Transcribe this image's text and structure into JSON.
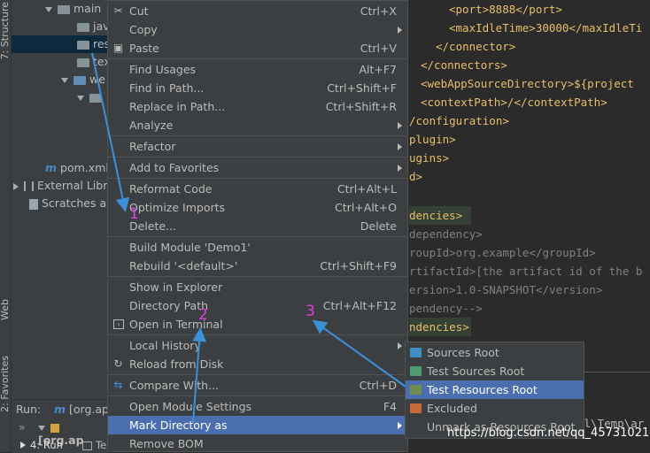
{
  "toolstrip": {
    "structure_label": "7: Structure",
    "web_label": "Web",
    "favorites_label": "2: Favorites"
  },
  "tree": {
    "rows": [
      {
        "label": "main"
      },
      {
        "label": "java"
      },
      {
        "label": "res"
      },
      {
        "label": "tex"
      },
      {
        "label": "we"
      },
      {
        "label": ""
      },
      {
        "label": "pom.xml"
      },
      {
        "label": "External Libr"
      },
      {
        "label": "Scratches an"
      }
    ]
  },
  "run_panel": {
    "run_label": "Run:",
    "run_config": "[org.ap",
    "run_config2": "[org.ap",
    "tab_run": "4: Run",
    "tab_te": "Te"
  },
  "editor": {
    "lines": [
      {
        "indent": "    ",
        "text": "<port>8888</port>"
      },
      {
        "indent": "    ",
        "text": "<maxIdleTime>30000</maxIdleTi"
      },
      {
        "indent": "  ",
        "text": "</connector>"
      },
      {
        "indent": "",
        "text": "</connectors>"
      },
      {
        "indent": "",
        "text": "<webAppSourceDirectory>${project"
      },
      {
        "indent": "",
        "text": "<contextPath>/</contextPath>"
      },
      {
        "indent": "",
        "text": "/configuration>"
      },
      {
        "indent": "",
        "text": "plugin>"
      },
      {
        "indent": "",
        "text": "ugins>"
      },
      {
        "indent": "",
        "text": "d>"
      },
      {
        "indent": "",
        "text": ""
      },
      {
        "indent": "",
        "text": "dencies>"
      },
      {
        "indent": "",
        "text": "dependency>"
      },
      {
        "indent": "",
        "text": "roupId>org.example</groupId>"
      },
      {
        "indent": "",
        "text": "rtifactId>[the artifact id of the b"
      },
      {
        "indent": "",
        "text": "ersion>1.0-SNAPSHOT</version>"
      },
      {
        "indent": "",
        "text": "pendency-->"
      },
      {
        "indent": "",
        "text": "ndencies>"
      }
    ],
    "bottom_text": "al\\Temp\\ar"
  },
  "menu": {
    "items": [
      {
        "label": "Cut",
        "shortcut": "Ctrl+X",
        "icon": "scissors-icon"
      },
      {
        "label": "Copy",
        "shortcut": "",
        "submenu": true
      },
      {
        "label": "Paste",
        "shortcut": "Ctrl+V",
        "icon": "clipboard-icon"
      },
      {
        "label": "Find Usages",
        "shortcut": "Alt+F7"
      },
      {
        "label": "Find in Path...",
        "shortcut": "Ctrl+Shift+F"
      },
      {
        "label": "Replace in Path...",
        "shortcut": "Ctrl+Shift+R"
      },
      {
        "label": "Analyze",
        "shortcut": "",
        "submenu": true
      },
      {
        "label": "Refactor",
        "shortcut": "",
        "submenu": true
      },
      {
        "label": "Add to Favorites",
        "shortcut": "",
        "submenu": true
      },
      {
        "label": "Reformat Code",
        "shortcut": "Ctrl+Alt+L"
      },
      {
        "label": "Optimize Imports",
        "shortcut": "Ctrl+Alt+O"
      },
      {
        "label": "Delete...",
        "shortcut": "Delete"
      },
      {
        "label": "Build Module 'Demo1'",
        "shortcut": ""
      },
      {
        "label": "Rebuild '<default>'",
        "shortcut": "Ctrl+Shift+F9"
      },
      {
        "label": "Show in Explorer",
        "shortcut": ""
      },
      {
        "label": "Directory Path",
        "shortcut": "Ctrl+Alt+F12"
      },
      {
        "label": "Open in Terminal",
        "shortcut": "",
        "icon": "terminal-icon"
      },
      {
        "label": "Local History",
        "shortcut": "",
        "submenu": true
      },
      {
        "label": "Reload from Disk",
        "shortcut": "",
        "icon": "reload-icon"
      },
      {
        "label": "Compare With...",
        "shortcut": "Ctrl+D",
        "icon": "compare-icon"
      },
      {
        "label": "Open Module Settings",
        "shortcut": "F4"
      },
      {
        "label": "Mark Directory as",
        "shortcut": "",
        "submenu": true,
        "selected": true
      },
      {
        "label": "Remove BOM",
        "shortcut": ""
      }
    ]
  },
  "submenu": {
    "items": [
      {
        "label": "Sources Root",
        "color": "#3d8fc4"
      },
      {
        "label": "Test Sources Root",
        "color": "#4e9a73"
      },
      {
        "label": "Test Resources Root",
        "color": "#6f8e4f",
        "selected": true
      },
      {
        "label": "Excluded",
        "color": "#c8693b"
      },
      {
        "label": "Unmark as Resources Root",
        "color": ""
      }
    ]
  },
  "annotations": {
    "n1": "1",
    "n2": "2",
    "n3": "3",
    "color": "#e040e0",
    "arrow_color": "#3d8fd8"
  },
  "watermark": "https://blog.csdn.net/qq_45731021"
}
